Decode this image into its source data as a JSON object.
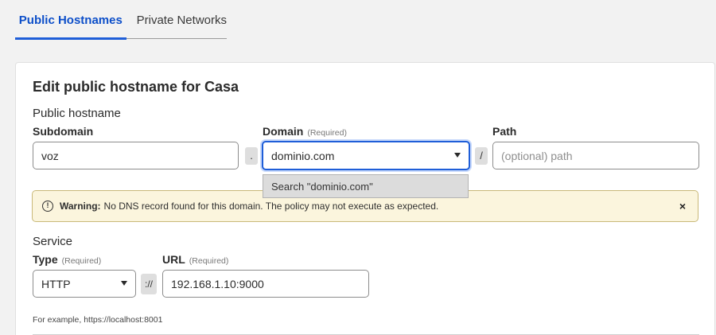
{
  "tabs": [
    {
      "label": "Public Hostnames",
      "active": true
    },
    {
      "label": "Private Networks",
      "active": false
    }
  ],
  "card": {
    "title": "Edit public hostname for Casa",
    "public_hostname_section": "Public hostname",
    "subdomain": {
      "label": "Subdomain",
      "value": "voz"
    },
    "dot_separator": ".",
    "domain": {
      "label": "Domain",
      "required": "(Required)",
      "value": "dominio.com"
    },
    "slash_separator": "/",
    "path": {
      "label": "Path",
      "placeholder": "(optional) path"
    },
    "domain_dropdown_option": "Search \"dominio.com\"",
    "warning": {
      "title": "Warning:",
      "message": "No DNS record found for this domain. The policy may not execute as expected.",
      "close_icon": "×"
    },
    "service_section": "Service",
    "type": {
      "label": "Type",
      "required": "(Required)",
      "value": "HTTP"
    },
    "scheme_separator": "://",
    "url": {
      "label": "URL",
      "required": "(Required)",
      "value": "192.168.1.10:9000"
    },
    "hint": "For example, https://localhost:8001"
  },
  "colors": {
    "accent": "#1f5ed8",
    "warning_bg": "#fbf5dd",
    "warning_border": "#c9b979"
  }
}
